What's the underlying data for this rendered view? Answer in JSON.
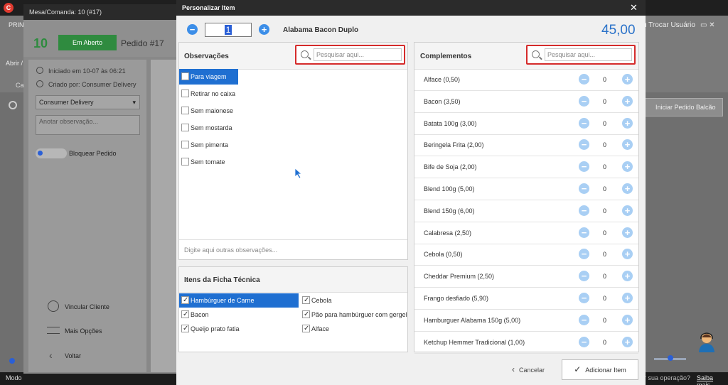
{
  "background": {
    "menu_prefix": "PRIN",
    "abrir": "Abrir /",
    "ca": "Ca",
    "trocar_usuario": "u Trocar Usuário",
    "iniciar_balcao": "Iniciar Pedido Balcão",
    "status_left": "Modo",
    "status_right_q": "r sua operação?",
    "status_right_link": "Saiba mais"
  },
  "mesa": {
    "title": "Mesa/Comanda: 10 (#17)",
    "number": "10",
    "status": "Em Aberto",
    "pedido": "Pedido #17",
    "iniciado": "Iniciado em 10-07 às 06:21",
    "criado": "Criado por: Consumer Delivery",
    "client": "Consumer Delivery",
    "obs_placeholder": "Anotar observação...",
    "bloquear": "Bloquear Pedido",
    "vincular": "Vincular Cliente",
    "mais": "Mais Opções",
    "voltar": "Voltar"
  },
  "dialog": {
    "title": "Personalizar Item",
    "quantity": "1",
    "product": "Alabama Bacon Duplo",
    "price": "45,00",
    "cancel": "Cancelar",
    "add": "Adicionar Item"
  },
  "observacoes": {
    "label": "Observações",
    "search_placeholder": "Pesquisar aqui...",
    "other_placeholder": "Digite aqui outras observações...",
    "items": [
      {
        "label": "Para viagem",
        "selected": true
      },
      {
        "label": "Retirar no caixa",
        "selected": false
      },
      {
        "label": "Sem maionese",
        "selected": false
      },
      {
        "label": "Sem mostarda",
        "selected": false
      },
      {
        "label": "Sem pimenta",
        "selected": false
      },
      {
        "label": "Sem tomate",
        "selected": false
      }
    ]
  },
  "ficha": {
    "label": "Itens da Ficha Técnica",
    "items": [
      {
        "label": "Hambúrguer de Carne",
        "checked": true,
        "selected": true
      },
      {
        "label": "Cebola",
        "checked": true,
        "selected": false
      },
      {
        "label": "Bacon",
        "checked": true,
        "selected": false
      },
      {
        "label": "Pão para hambúrguer com gergelim",
        "checked": true,
        "selected": false
      },
      {
        "label": "Queijo prato fatia",
        "checked": true,
        "selected": false
      },
      {
        "label": "Alface",
        "checked": true,
        "selected": false
      }
    ]
  },
  "complementos": {
    "label": "Complementos",
    "search_placeholder": "Pesquisar aqui...",
    "items": [
      {
        "name": "Alface (0,50)",
        "qty": "0"
      },
      {
        "name": "Bacon (3,50)",
        "qty": "0"
      },
      {
        "name": "Batata 100g (3,00)",
        "qty": "0"
      },
      {
        "name": "Beringela Frita (2,00)",
        "qty": "0"
      },
      {
        "name": "Bife de Soja (2,00)",
        "qty": "0"
      },
      {
        "name": "Blend 100g (5,00)",
        "qty": "0"
      },
      {
        "name": "Blend 150g (6,00)",
        "qty": "0"
      },
      {
        "name": "Calabresa (2,50)",
        "qty": "0"
      },
      {
        "name": "Cebola (0,50)",
        "qty": "0"
      },
      {
        "name": "Cheddar Premium (2,50)",
        "qty": "0"
      },
      {
        "name": "Frango desfiado (5,90)",
        "qty": "0"
      },
      {
        "name": "Hamburguer Alabama 150g (5,00)",
        "qty": "0"
      },
      {
        "name": "Ketchup Hemmer Tradicional (1,00)",
        "qty": "0"
      }
    ]
  }
}
